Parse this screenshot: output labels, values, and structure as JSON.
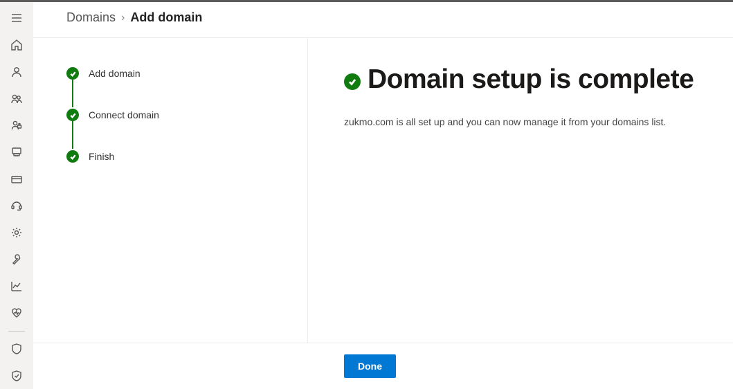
{
  "breadcrumb": {
    "parent": "Domains",
    "current": "Add domain"
  },
  "steps": [
    {
      "label": "Add domain"
    },
    {
      "label": "Connect domain"
    },
    {
      "label": "Finish"
    }
  ],
  "detail": {
    "title": "Domain setup is complete",
    "description": "zukmo.com is all set up and you can now manage it from your domains list."
  },
  "footer": {
    "done_label": "Done"
  }
}
